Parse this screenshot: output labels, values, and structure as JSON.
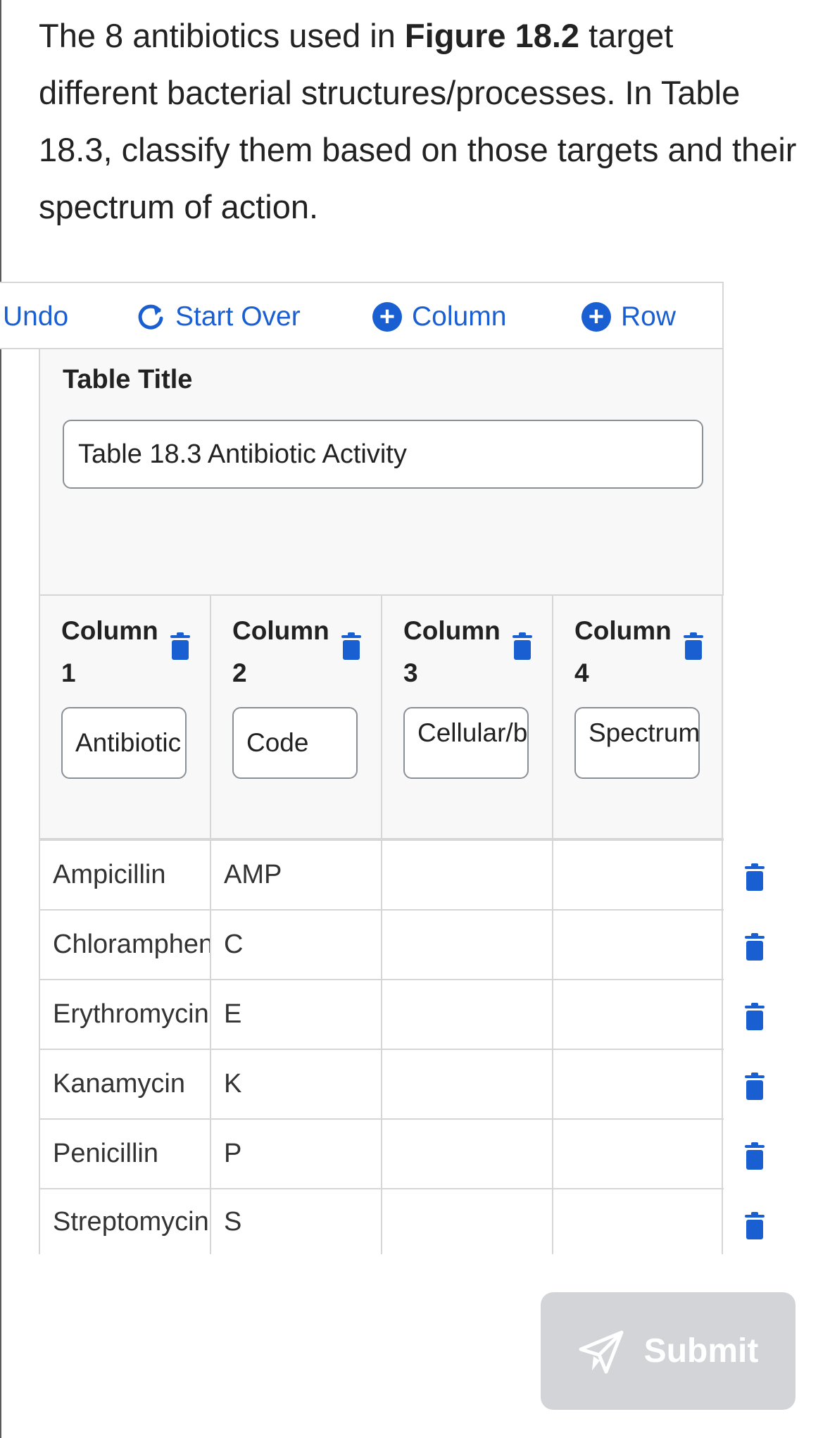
{
  "instructions": {
    "prefix": "The 8 antibiotics used in ",
    "figure_ref": "Figure 18.2",
    "suffix": " target different bacterial structures/processes. In Table 18.3, classify them based on those targets and their spectrum of action."
  },
  "toolbar": {
    "undo_label": "Undo",
    "start_over_label": "Start Over",
    "add_column_label": "Column",
    "add_row_label": "Row"
  },
  "table_title": {
    "label": "Table Title",
    "value": "Table 18.3 Antibiotic Activity"
  },
  "columns": [
    {
      "name": "Column 1",
      "value": "Antibiotic"
    },
    {
      "name": "Column 2",
      "value": "Code"
    },
    {
      "name": "Column 3",
      "value": "Cellular/bacterial"
    },
    {
      "name": "Column 4",
      "value": "Spectrum of action"
    }
  ],
  "rows": [
    [
      "Ampicillin",
      "AMP",
      "",
      ""
    ],
    [
      "Chloramphenicol",
      "C",
      "",
      ""
    ],
    [
      "Erythromycin",
      "E",
      "",
      ""
    ],
    [
      "Kanamycin",
      "K",
      "",
      ""
    ],
    [
      "Penicillin",
      "P",
      "",
      ""
    ],
    [
      "Streptomycin",
      "S",
      "",
      ""
    ]
  ],
  "submit_label": "Submit",
  "colors": {
    "accent": "#1a5fd1",
    "submit_disabled": "#d2d4d8"
  }
}
